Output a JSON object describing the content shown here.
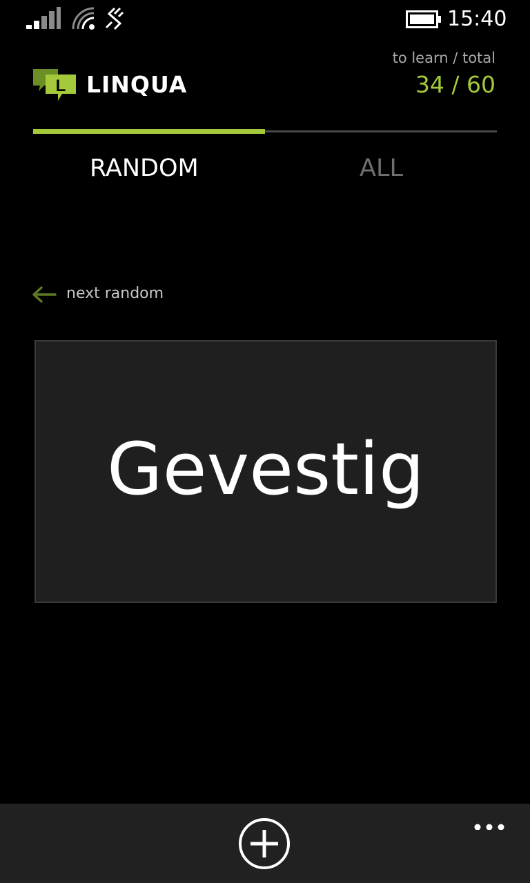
{
  "status_bar": {
    "time": "15:40",
    "icons": [
      "signal-icon",
      "wifi-icon",
      "data-sync-icon",
      "battery-icon"
    ]
  },
  "header": {
    "app_name": "LINQUA",
    "logo_letter": "L",
    "counter_label": "to learn / total",
    "counter_value": "34 / 60"
  },
  "progress": {
    "fraction": 0.5
  },
  "tabs": [
    {
      "label": "RANDOM",
      "active": true
    },
    {
      "label": "ALL",
      "active": false
    }
  ],
  "next_random": {
    "label": "next random",
    "icon": "arrow-left-icon"
  },
  "card": {
    "word": "Gevestig"
  },
  "app_bar": {
    "add_icon": "add-circle-icon",
    "more_icon": "more-dots-icon"
  },
  "colors": {
    "accent": "#a4c93a",
    "background": "#000000",
    "card": "#1f1f1f",
    "app_bar": "#212121"
  }
}
